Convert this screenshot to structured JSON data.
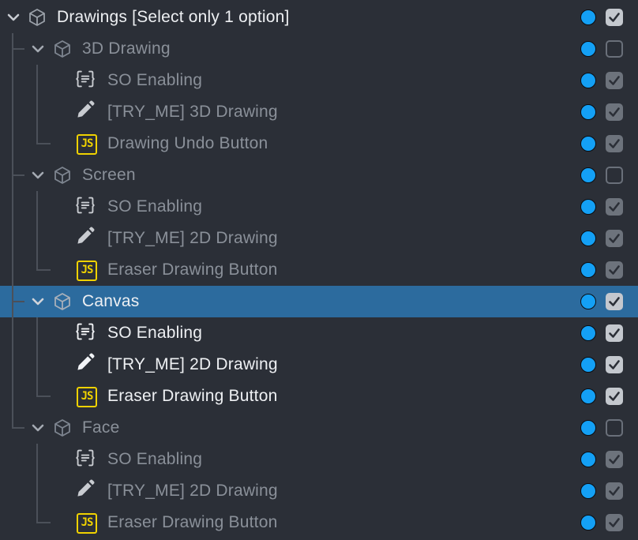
{
  "tree": {
    "root": {
      "label": "Drawings [Select only 1 option]",
      "expanded": true,
      "enabled": true,
      "checked": true,
      "icon": "cube-icon"
    },
    "groups": [
      {
        "label": "3D Drawing",
        "expanded": true,
        "checked": false,
        "icon": "cube-icon",
        "children": [
          {
            "label": "SO Enabling",
            "icon": "script-icon",
            "checked": true
          },
          {
            "label": "[TRY_ME] 3D Drawing",
            "icon": "pencil-icon",
            "checked": true
          },
          {
            "label": "Drawing Undo Button",
            "icon": "js-icon",
            "icon_text": "JS",
            "checked": true
          }
        ]
      },
      {
        "label": "Screen",
        "expanded": true,
        "checked": false,
        "icon": "cube-icon",
        "children": [
          {
            "label": "SO Enabling",
            "icon": "script-icon",
            "checked": true
          },
          {
            "label": "[TRY_ME] 2D Drawing",
            "icon": "pencil-icon",
            "checked": true
          },
          {
            "label": "Eraser Drawing Button",
            "icon": "js-icon",
            "icon_text": "JS",
            "checked": true
          }
        ]
      },
      {
        "label": "Canvas",
        "expanded": true,
        "checked": true,
        "selected": true,
        "icon": "cube-icon",
        "children": [
          {
            "label": "SO Enabling",
            "icon": "script-icon",
            "checked": true
          },
          {
            "label": "[TRY_ME] 2D Drawing",
            "icon": "pencil-icon",
            "checked": true
          },
          {
            "label": "Eraser Drawing Button",
            "icon": "js-icon",
            "icon_text": "JS",
            "checked": true
          }
        ]
      },
      {
        "label": "Face",
        "expanded": true,
        "checked": false,
        "icon": "cube-icon",
        "children": [
          {
            "label": "SO Enabling",
            "icon": "script-icon",
            "checked": true
          },
          {
            "label": "[TRY_ME] 2D Drawing",
            "icon": "pencil-icon",
            "checked": true
          },
          {
            "label": "Eraser Drawing Button",
            "icon": "js-icon",
            "icon_text": "JS",
            "checked": true
          }
        ]
      }
    ]
  },
  "colors": {
    "background": "#2b2f37",
    "selection": "#2c6b9e",
    "visibility_dot": "#14a0f5",
    "js_icon": "#f0d200",
    "text_active": "#eef0f3",
    "text_inactive": "#8a9099"
  }
}
